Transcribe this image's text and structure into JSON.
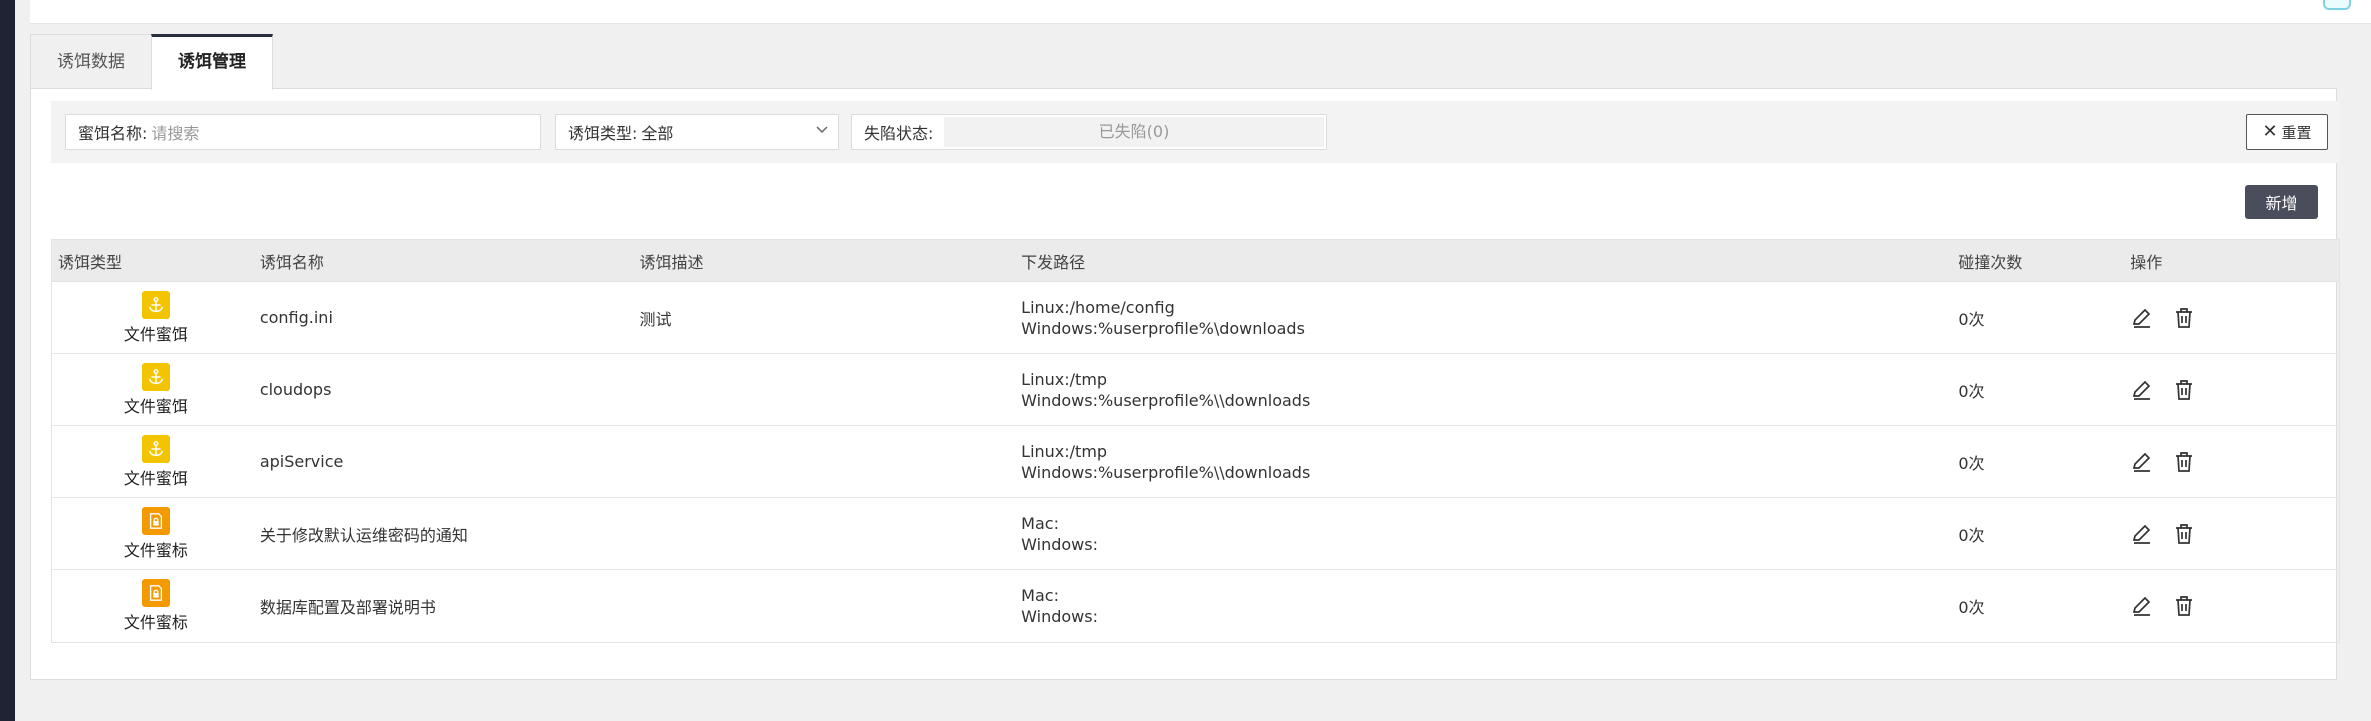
{
  "tabs": [
    {
      "label": "诱饵数据",
      "active": false
    },
    {
      "label": "诱饵管理",
      "active": true
    }
  ],
  "filters": {
    "name_label": "蜜饵名称:",
    "name_placeholder": "请搜索",
    "type_label": "诱饵类型:",
    "type_value": "全部",
    "status_label": "失陷状态:",
    "status_value": "已失陷(0)",
    "reset_label": "重置"
  },
  "add_label": "新增",
  "table": {
    "headers": [
      "诱饵类型",
      "诱饵名称",
      "诱饵描述",
      "下发路径",
      "碰撞次数",
      "操作"
    ],
    "rows": [
      {
        "type": "文件蜜饵",
        "icon": "anchor-icon",
        "name": "config.ini",
        "desc": "测试",
        "path1": "Linux:/home/config",
        "path2": "Windows:%userprofile%\\downloads",
        "hits": "0次"
      },
      {
        "type": "文件蜜饵",
        "icon": "anchor-icon",
        "name": "cloudops",
        "desc": "",
        "path1": "Linux:/tmp",
        "path2": "Windows:%userprofile%\\\\downloads",
        "hits": "0次"
      },
      {
        "type": "文件蜜饵",
        "icon": "anchor-icon",
        "name": "apiService",
        "desc": "",
        "path1": "Linux:/tmp",
        "path2": "Windows:%userprofile%\\\\downloads",
        "hits": "0次"
      },
      {
        "type": "文件蜜标",
        "icon": "doc-lock-icon",
        "name": "关于修改默认运维密码的通知",
        "desc": "",
        "path1": "Mac:",
        "path2": "Windows:",
        "hits": "0次"
      },
      {
        "type": "文件蜜标",
        "icon": "doc-lock-icon",
        "name": "数据库配置及部署说明书",
        "desc": "",
        "path1": "Mac:",
        "path2": "Windows:",
        "hits": "0次"
      }
    ]
  },
  "colors": {
    "bait_icon": "#f5c400",
    "token_icon": "#f39a00",
    "add_button": "#4a4e5c",
    "active_tab_border": "#2a2f3f"
  }
}
